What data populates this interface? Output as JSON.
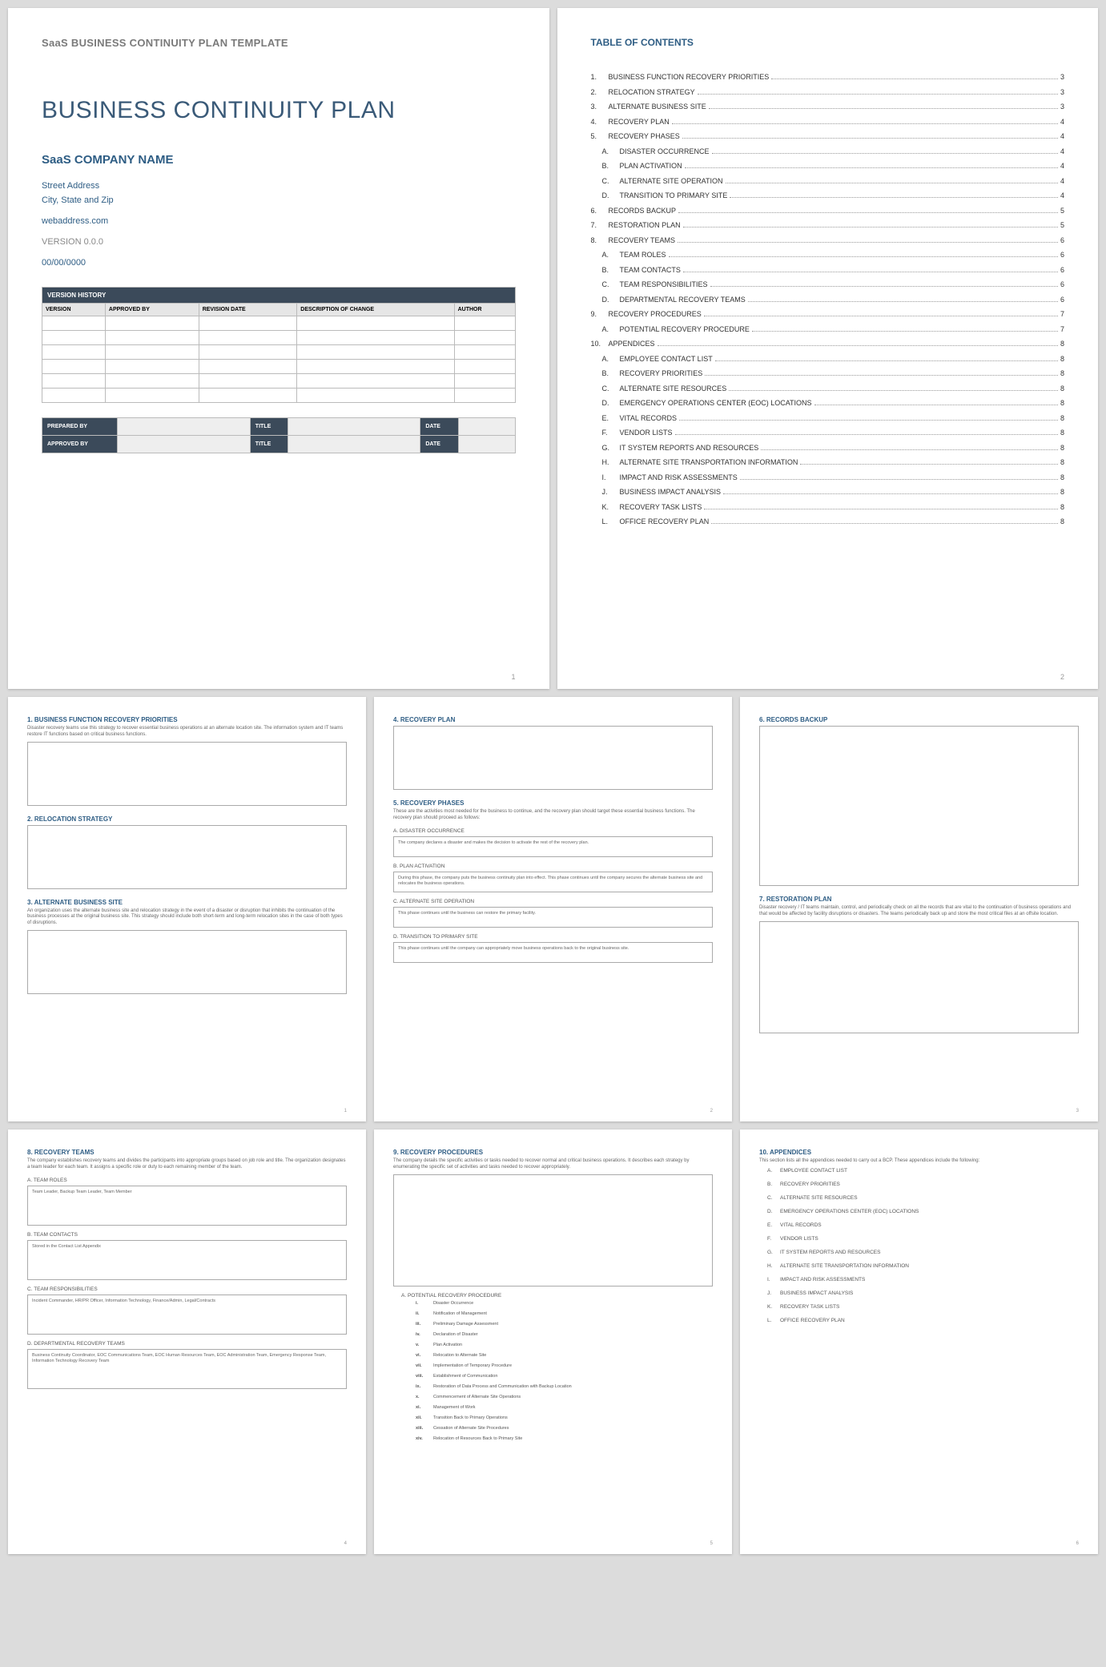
{
  "page1": {
    "template_label": "SaaS BUSINESS CONTINUITY PLAN TEMPLATE",
    "title": "BUSINESS CONTINUITY PLAN",
    "company": "SaaS COMPANY NAME",
    "street": "Street Address",
    "city": "City, State and Zip",
    "web": "webaddress.com",
    "version": "VERSION 0.0.0",
    "date": "00/00/0000",
    "vh_title": "VERSION HISTORY",
    "vh_headers": [
      "VERSION",
      "APPROVED BY",
      "REVISION DATE",
      "DESCRIPTION OF CHANGE",
      "AUTHOR"
    ],
    "sign": {
      "prepared": "PREPARED BY",
      "approved": "APPROVED BY",
      "title": "TITLE",
      "date": "DATE"
    },
    "pnum": "1"
  },
  "page2": {
    "title": "TABLE OF CONTENTS",
    "items": [
      {
        "n": "1.",
        "l": "BUSINESS FUNCTION RECOVERY PRIORITIES",
        "p": "3",
        "sub": false
      },
      {
        "n": "2.",
        "l": "RELOCATION STRATEGY",
        "p": "3",
        "sub": false
      },
      {
        "n": "3.",
        "l": "ALTERNATE BUSINESS SITE",
        "p": "3",
        "sub": false
      },
      {
        "n": "4.",
        "l": "RECOVERY PLAN",
        "p": "4",
        "sub": false
      },
      {
        "n": "5.",
        "l": "RECOVERY PHASES",
        "p": "4",
        "sub": false
      },
      {
        "n": "A.",
        "l": "DISASTER OCCURRENCE",
        "p": "4",
        "sub": true
      },
      {
        "n": "B.",
        "l": "PLAN ACTIVATION",
        "p": "4",
        "sub": true
      },
      {
        "n": "C.",
        "l": "ALTERNATE SITE OPERATION",
        "p": "4",
        "sub": true
      },
      {
        "n": "D.",
        "l": "TRANSITION TO PRIMARY SITE",
        "p": "4",
        "sub": true
      },
      {
        "n": "6.",
        "l": "RECORDS BACKUP",
        "p": "5",
        "sub": false
      },
      {
        "n": "7.",
        "l": "RESTORATION PLAN",
        "p": "5",
        "sub": false
      },
      {
        "n": "8.",
        "l": "RECOVERY TEAMS",
        "p": "6",
        "sub": false
      },
      {
        "n": "A.",
        "l": "TEAM ROLES",
        "p": "6",
        "sub": true
      },
      {
        "n": "B.",
        "l": "TEAM CONTACTS",
        "p": "6",
        "sub": true
      },
      {
        "n": "C.",
        "l": "TEAM RESPONSIBILITIES",
        "p": "6",
        "sub": true
      },
      {
        "n": "D.",
        "l": "DEPARTMENTAL RECOVERY TEAMS",
        "p": "6",
        "sub": true
      },
      {
        "n": "9.",
        "l": "RECOVERY PROCEDURES",
        "p": "7",
        "sub": false
      },
      {
        "n": "A.",
        "l": "POTENTIAL RECOVERY PROCEDURE",
        "p": "7",
        "sub": true
      },
      {
        "n": "10.",
        "l": "APPENDICES",
        "p": "8",
        "sub": false
      },
      {
        "n": "A.",
        "l": "EMPLOYEE CONTACT LIST",
        "p": "8",
        "sub": true
      },
      {
        "n": "B.",
        "l": "RECOVERY PRIORITIES",
        "p": "8",
        "sub": true
      },
      {
        "n": "C.",
        "l": "ALTERNATE SITE RESOURCES",
        "p": "8",
        "sub": true
      },
      {
        "n": "D.",
        "l": "EMERGENCY OPERATIONS CENTER (EOC) LOCATIONS",
        "p": "8",
        "sub": true
      },
      {
        "n": "E.",
        "l": "VITAL RECORDS",
        "p": "8",
        "sub": true
      },
      {
        "n": "F.",
        "l": "VENDOR LISTS",
        "p": "8",
        "sub": true
      },
      {
        "n": "G.",
        "l": "IT SYSTEM REPORTS AND RESOURCES",
        "p": "8",
        "sub": true
      },
      {
        "n": "H.",
        "l": "ALTERNATE SITE TRANSPORTATION INFORMATION",
        "p": "8",
        "sub": true
      },
      {
        "n": "I.",
        "l": "IMPACT AND RISK ASSESSMENTS",
        "p": "8",
        "sub": true
      },
      {
        "n": "J.",
        "l": "BUSINESS IMPACT ANALYSIS",
        "p": "8",
        "sub": true
      },
      {
        "n": "K.",
        "l": "RECOVERY TASK LISTS",
        "p": "8",
        "sub": true
      },
      {
        "n": "L.",
        "l": "OFFICE RECOVERY PLAN",
        "p": "8",
        "sub": true
      }
    ],
    "pnum": "2"
  },
  "page3": {
    "s1": {
      "h": "1. BUSINESS FUNCTION RECOVERY PRIORITIES",
      "d": "Disaster recovery teams use this strategy to recover essential business operations at an alternate location site. The information system and IT teams restore IT functions based on critical business functions."
    },
    "s2": {
      "h": "2. RELOCATION STRATEGY"
    },
    "s3": {
      "h": "3. ALTERNATE BUSINESS SITE",
      "d": "An organization uses the alternate business site and relocation strategy in the event of a disaster or disruption that inhibits the continuation of the business processes at the original business site. This strategy should include both short-term and long-term relocation sites in the case of both types of disruptions."
    },
    "pnum": "1"
  },
  "page4": {
    "s4": {
      "h": "4. RECOVERY PLAN"
    },
    "s5": {
      "h": "5. RECOVERY PHASES",
      "d": "These are the activities most needed for the business to continue, and the recovery plan should target these essential business functions. The recovery plan should proceed as follows:"
    },
    "a": {
      "h": "A. DISASTER OCCURRENCE",
      "t": "The company declares a disaster and makes the decision to activate the rest of the recovery plan."
    },
    "b": {
      "h": "B. PLAN ACTIVATION",
      "t": "During this phase, the company puts the business continuity plan into effect. This phase continues until the company secures the alternate business site and relocates the business operations."
    },
    "c": {
      "h": "C. ALTERNATE SITE OPERATION",
      "t": "This phase continues until the business can restore the primary facility."
    },
    "d": {
      "h": "D. TRANSITION TO PRIMARY SITE",
      "t": "This phase continues until the company can appropriately move business operations back to the original business site."
    },
    "pnum": "2"
  },
  "page5": {
    "s6": {
      "h": "6. RECORDS BACKUP"
    },
    "s7": {
      "h": "7. RESTORATION PLAN",
      "d": "Disaster recovery / IT teams maintain, control, and periodically check on all the records that are vital to the continuation of business operations and that would be affected by facility disruptions or disasters. The teams periodically back up and store the most critical files at an offsite location."
    },
    "pnum": "3"
  },
  "page6": {
    "s8": {
      "h": "8. RECOVERY TEAMS",
      "d": "The company establishes recovery teams and divides the participants into appropriate groups based on job role and title. The organization designates a team leader for each team. It assigns a specific role or duty to each remaining member of the team."
    },
    "a": {
      "h": "A. TEAM ROLES",
      "t": "Team Leader, Backup Team Leader, Team Member"
    },
    "b": {
      "h": "B. TEAM CONTACTS",
      "t": "Stored in the Contact List Appendix"
    },
    "c": {
      "h": "C. TEAM RESPONSIBILITIES",
      "t": "Incident Commander, HR/PR Officer, Information Technology, Finance/Admin, Legal/Contracts"
    },
    "d": {
      "h": "D. DEPARTMENTAL RECOVERY TEAMS",
      "t": "Business Continuity Coordinator, EOC Communications Team, EOC Human Resources Team, EOC Administration Team, Emergency Response Team, Information Technology Recovery Team"
    },
    "pnum": "4"
  },
  "page7": {
    "s9": {
      "h": "9. RECOVERY PROCEDURES",
      "d": "The company details the specific activities or tasks needed to recover normal and critical business operations. It describes each strategy by enumerating the specific set of activities and tasks needed to recover appropriately."
    },
    "a": {
      "h": "A. POTENTIAL RECOVERY PROCEDURE"
    },
    "steps": [
      {
        "r": "i.",
        "t": "Disaster Occurrence"
      },
      {
        "r": "ii.",
        "t": "Notification of Management"
      },
      {
        "r": "iii.",
        "t": "Preliminary Damage Assessment"
      },
      {
        "r": "iv.",
        "t": "Declaration of Disaster"
      },
      {
        "r": "v.",
        "t": "Plan Activation"
      },
      {
        "r": "vi.",
        "t": "Relocation to Alternate Site"
      },
      {
        "r": "vii.",
        "t": "Implementation of Temporary Procedure"
      },
      {
        "r": "viii.",
        "t": "Establishment of Communication"
      },
      {
        "r": "ix.",
        "t": "Restoration of Data Process and Communication with Backup Location"
      },
      {
        "r": "x.",
        "t": "Commencement of Alternate Site Operations"
      },
      {
        "r": "xi.",
        "t": "Management of Work"
      },
      {
        "r": "xii.",
        "t": "Transition Back to Primary Operations"
      },
      {
        "r": "xiii.",
        "t": "Cessation of Alternate Site Procedures"
      },
      {
        "r": "xiv.",
        "t": "Relocation of Resources Back to Primary Site"
      }
    ],
    "pnum": "5"
  },
  "page8": {
    "s10": {
      "h": "10.  APPENDICES",
      "d": "This section lists all the appendices needed to carry out a BCP. These appendices include the following:"
    },
    "items": [
      {
        "r": "A.",
        "t": "EMPLOYEE CONTACT LIST"
      },
      {
        "r": "B.",
        "t": "RECOVERY PRIORITIES"
      },
      {
        "r": "C.",
        "t": "ALTERNATE SITE RESOURCES"
      },
      {
        "r": "D.",
        "t": "EMERGENCY OPERATIONS CENTER (EOC) LOCATIONS"
      },
      {
        "r": "E.",
        "t": "VITAL RECORDS"
      },
      {
        "r": "F.",
        "t": "VENDOR LISTS"
      },
      {
        "r": "G.",
        "t": "IT SYSTEM REPORTS AND RESOURCES"
      },
      {
        "r": "H.",
        "t": "ALTERNATE SITE TRANSPORTATION INFORMATION"
      },
      {
        "r": "I.",
        "t": "IMPACT AND RISK ASSESSMENTS"
      },
      {
        "r": "J.",
        "t": "BUSINESS IMPACT ANALYSIS"
      },
      {
        "r": "K.",
        "t": "RECOVERY TASK LISTS"
      },
      {
        "r": "L.",
        "t": "OFFICE RECOVERY PLAN"
      }
    ],
    "pnum": "6"
  }
}
